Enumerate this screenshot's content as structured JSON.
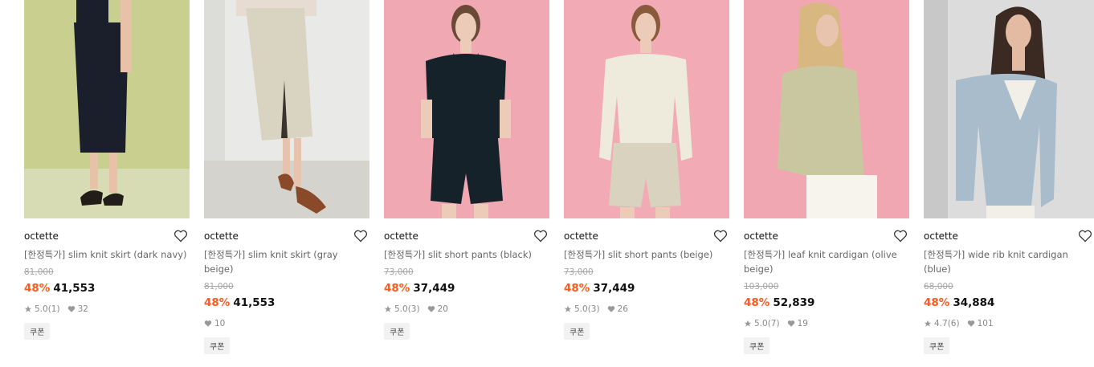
{
  "products": [
    {
      "brand": "octette",
      "title": "[한정특가] slim knit skirt (dark navy)",
      "original_price": "81,000",
      "discount": "48%",
      "price": "41,553",
      "rating": "5.0",
      "reviews": "(1)",
      "likes": "32",
      "coupon": "쿠폰",
      "colors": {
        "bg": "#c9d08f",
        "floor": "#d8dcb4",
        "garment": "#1b1f2b",
        "skin": "#e8c2a8"
      }
    },
    {
      "brand": "octette",
      "title": "[한정특가] slim knit skirt (gray beige)",
      "original_price": "81,000",
      "discount": "48%",
      "price": "41,553",
      "rating": "",
      "reviews": "",
      "likes": "10",
      "coupon": "쿠폰",
      "colors": {
        "bg": "#e9eae7",
        "floor": "#d5d3ce",
        "garment": "#d9d3c2",
        "skin": "#e6c3ac"
      }
    },
    {
      "brand": "octette",
      "title": "[한정특가] slit short pants (black)",
      "original_price": "73,000",
      "discount": "48%",
      "price": "37,449",
      "rating": "5.0",
      "reviews": "(3)",
      "likes": "20",
      "coupon": "쿠폰",
      "colors": {
        "bg": "#f0a9b3",
        "floor": "#eea1ab",
        "garment": "#15222a",
        "skin": "#eccbb8"
      }
    },
    {
      "brand": "octette",
      "title": "[한정특가] slit short pants (beige)",
      "original_price": "73,000",
      "discount": "48%",
      "price": "37,449",
      "rating": "5.0",
      "reviews": "(3)",
      "likes": "26",
      "coupon": "쿠폰",
      "colors": {
        "bg": "#f2aab5",
        "floor": "#efa4ae",
        "garment": "#eeeadc",
        "skin": "#ecccb9"
      }
    },
    {
      "brand": "octette",
      "title": "[한정특가] leaf knit cardigan (olive beige)",
      "original_price": "103,000",
      "discount": "48%",
      "price": "52,839",
      "rating": "5.0",
      "reviews": "(7)",
      "likes": "19",
      "coupon": "쿠폰",
      "colors": {
        "bg": "#f0a7b2",
        "floor": "#eea3ae",
        "garment": "#c8c7a0",
        "skin": "#e8c4ae"
      }
    },
    {
      "brand": "octette",
      "title": "[한정특가] wide rib knit cardigan (blue)",
      "original_price": "68,000",
      "discount": "48%",
      "price": "34,884",
      "rating": "4.7",
      "reviews": "(6)",
      "likes": "101",
      "coupon": "쿠폰",
      "colors": {
        "bg": "#dcdcdc",
        "floor": "#cfcfcf",
        "garment": "#a8bccb",
        "skin": "#e3bba3"
      }
    }
  ]
}
